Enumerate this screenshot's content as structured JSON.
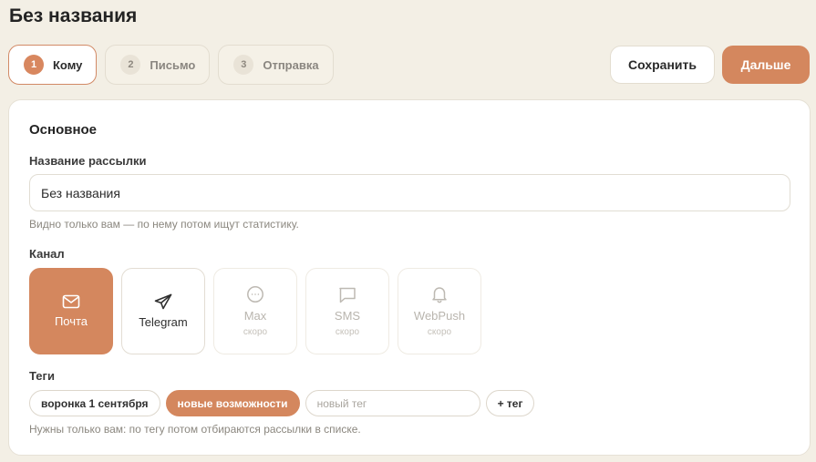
{
  "page": {
    "title": "Без названия"
  },
  "steps": [
    {
      "num": "1",
      "label": "Кому",
      "active": true
    },
    {
      "num": "2",
      "label": "Письмо",
      "active": false
    },
    {
      "num": "3",
      "label": "Отправка",
      "active": false
    }
  ],
  "actions": {
    "save_label": "Сохранить",
    "next_label": "Дальше"
  },
  "form": {
    "section_title": "Основное",
    "name_label": "Название рассылки",
    "name_value": "Без названия",
    "name_hint": "Видно только вам — по нему потом ищут статистику.",
    "channel_label": "Канал",
    "channels": [
      {
        "label": "Почта",
        "icon": "mail-icon",
        "state": "selected",
        "soon": ""
      },
      {
        "label": "Telegram",
        "icon": "send-icon",
        "state": "available",
        "soon": ""
      },
      {
        "label": "Max",
        "icon": "chat-circle-icon",
        "state": "disabled",
        "soon": "скоро"
      },
      {
        "label": "SMS",
        "icon": "message-square-icon",
        "state": "disabled",
        "soon": "скоро"
      },
      {
        "label": "WebPush",
        "icon": "bell-icon",
        "state": "disabled",
        "soon": "скоро"
      }
    ],
    "tags_label": "Теги",
    "tags": [
      {
        "label": "воронка 1 сентября",
        "selected": false
      },
      {
        "label": "новые возможности",
        "selected": true
      }
    ],
    "new_tag_placeholder": "новый тег",
    "add_tag_label": "+ тег",
    "tags_hint": "Нужны только вам: по тегу потом отбираются рассылки в списке."
  },
  "colors": {
    "accent": "#d4875e",
    "background": "#f3efe5",
    "card": "#ffffff",
    "muted_text": "#8b877f"
  }
}
